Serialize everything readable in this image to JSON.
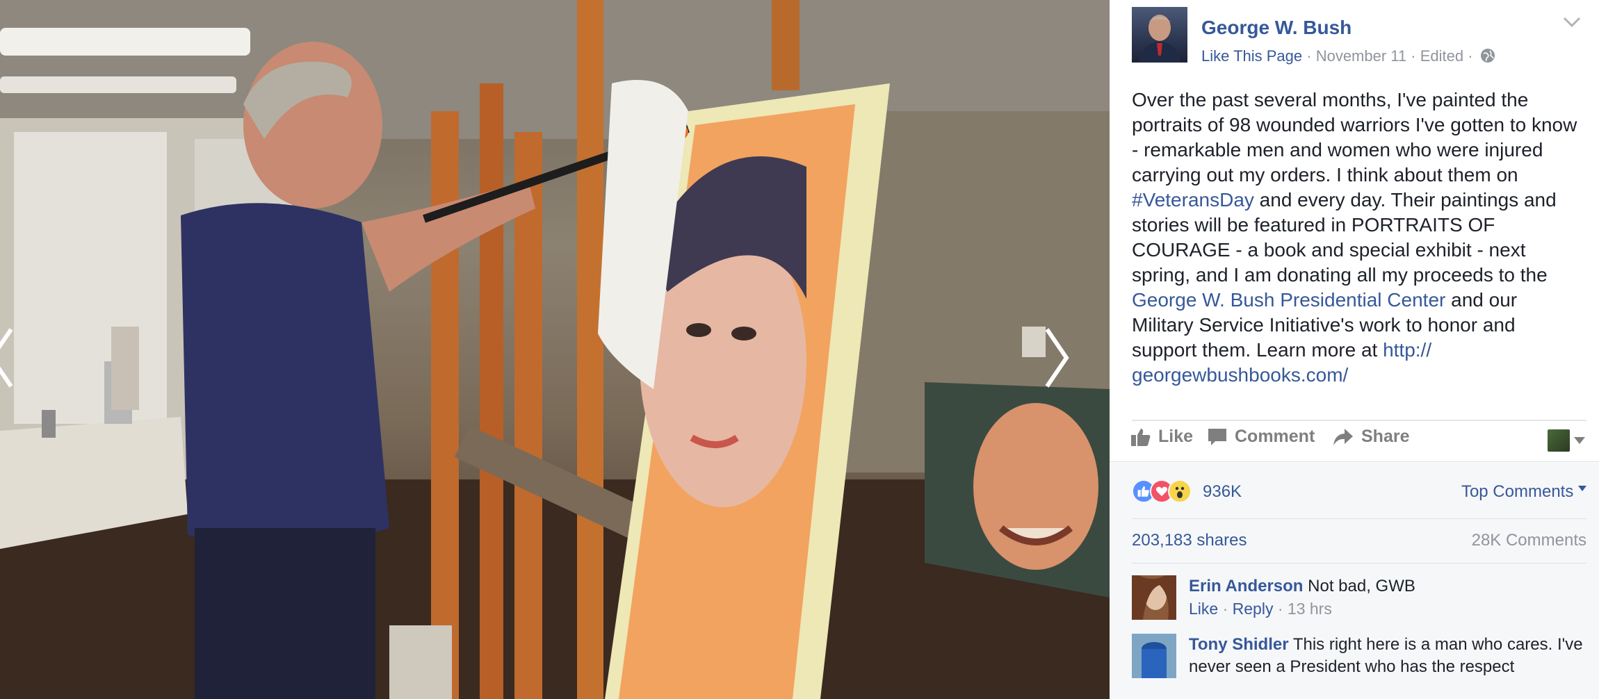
{
  "post": {
    "page_name": "George W. Bush",
    "like_page": "Like This Page",
    "date": "November 11",
    "edited": "Edited",
    "sep": " · ",
    "text_1": "Over the past several months, I've painted the portraits of 98 wounded warriors I've gotten to know - remarkable men and women who were injured carrying out my orders. I think about them on ",
    "hashtag": "#VeteransDay",
    "text_2": " and every day. Their paintings and stories will be featured in PORTRAITS OF COURAGE - a book and special exhibit - next spring, and I am donating all my proceeds to the ",
    "center_link": "George W. Bush Presidential Center",
    "text_3": " and our Military Service Initiative's work to honor and support them. Learn more at ",
    "url_link": "http:// georgewbushbooks.com/"
  },
  "actions": {
    "like": "Like",
    "comment": "Comment",
    "share": "Share"
  },
  "stats": {
    "reactions_count": "936K",
    "top_comments": "Top Comments",
    "shares": "203,183 shares",
    "comments_count": "28K Comments"
  },
  "comments": [
    {
      "author": "Erin Anderson",
      "text": "Not bad, GWB",
      "like": "Like",
      "reply": "Reply",
      "time": "13 hrs"
    },
    {
      "author": "Tony Shidler",
      "text": "This right here is a man who cares. I've never seen a President who has the respect"
    }
  ],
  "icons": {
    "prev": "chevron-left-icon",
    "next": "chevron-right-icon",
    "globe": "globe-icon",
    "menu": "chevron-down-icon",
    "like": "thumbs-up-icon",
    "comment": "comment-bubble-icon",
    "share": "share-arrow-icon"
  },
  "colors": {
    "link": "#365899",
    "muted": "#90949c",
    "action": "#7f7f7f",
    "lower_bg": "#f6f7f9"
  }
}
